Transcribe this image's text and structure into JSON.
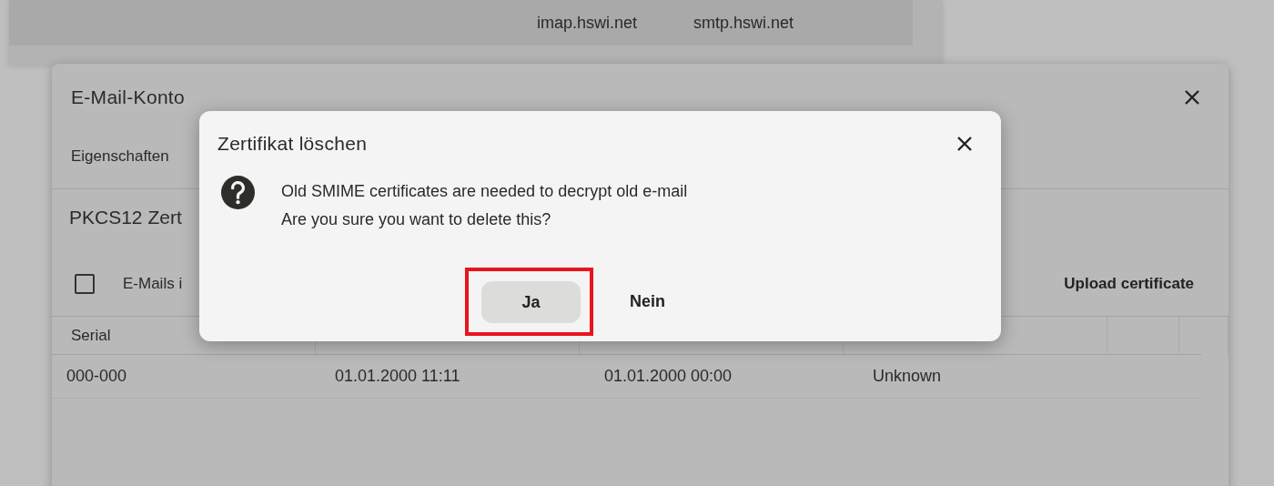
{
  "back_window": {
    "row": [
      "imap.hswi.net",
      "smtp.hswi.net"
    ]
  },
  "account_dialog": {
    "title": "E-Mail-Konto",
    "tabs": [
      {
        "label": "Eigenschaften",
        "selected": false
      }
    ],
    "section_title": "PKCS12 Zert",
    "option": {
      "label": "E-Mails i",
      "checked": false
    },
    "upload_button": "Upload certificate",
    "table": {
      "columns": [
        "Serial"
      ],
      "rows": [
        [
          "000-000",
          "01.01.2000 11:11",
          "01.01.2000 00:00",
          "Unknown"
        ]
      ]
    }
  },
  "confirm_dialog": {
    "title": "Zertifikat löschen",
    "message": [
      "Old SMIME certificates are needed to decrypt old e-mail",
      "Are you sure you want to delete this?"
    ],
    "buttons": [
      {
        "label": "Ja",
        "kind": "filled",
        "highlighted": true
      },
      {
        "label": "Nein",
        "kind": "text",
        "highlighted": false
      }
    ]
  }
}
